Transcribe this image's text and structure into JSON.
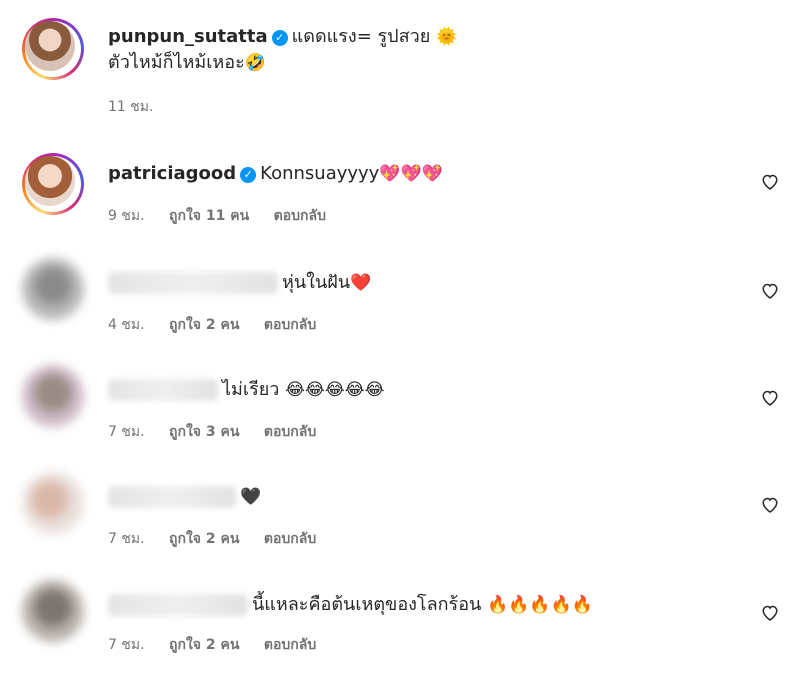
{
  "caption": {
    "username": "punpun_sutatta",
    "text_line1": "แดดแรง= รูปสวย",
    "emoji_line1": "🌞",
    "text_line2": "ตัวไหม้ก็ไหม้เหอะ",
    "emoji_line2": "🤣",
    "time": "11 ชม."
  },
  "comments": [
    {
      "username": "patriciagood",
      "verified": true,
      "text": "Konnsuayyyy",
      "emoji": "💖💖💖",
      "time": "9 ชม.",
      "likes": "ถูกใจ 11 คน",
      "reply": "ตอบกลับ"
    },
    {
      "text": "หุ่นในฝัน",
      "emoji": "❤️",
      "time": "4 ชม.",
      "likes": "ถูกใจ 2 คน",
      "reply": "ตอบกลับ"
    },
    {
      "text": "ไม่เรียว",
      "emoji": "😂😂😂😂😂",
      "time": "7 ชม.",
      "likes": "ถูกใจ 3 คน",
      "reply": "ตอบกลับ"
    },
    {
      "text": "",
      "emoji": "🖤",
      "time": "7 ชม.",
      "likes": "ถูกใจ 2 คน",
      "reply": "ตอบกลับ"
    },
    {
      "text": "นี้แหละคือต้นเหตุของโลกร้อน",
      "emoji": "🔥🔥🔥🔥🔥",
      "time": "7 ชม.",
      "likes": "ถูกใจ 2 คน",
      "reply": "ตอบกลับ"
    }
  ],
  "icons": {
    "verified": "verified-badge-icon",
    "like": "heart-outline-icon"
  },
  "colors": {
    "verified": "#0095f6",
    "meta_text": "#737373",
    "primary_text": "#262626"
  }
}
